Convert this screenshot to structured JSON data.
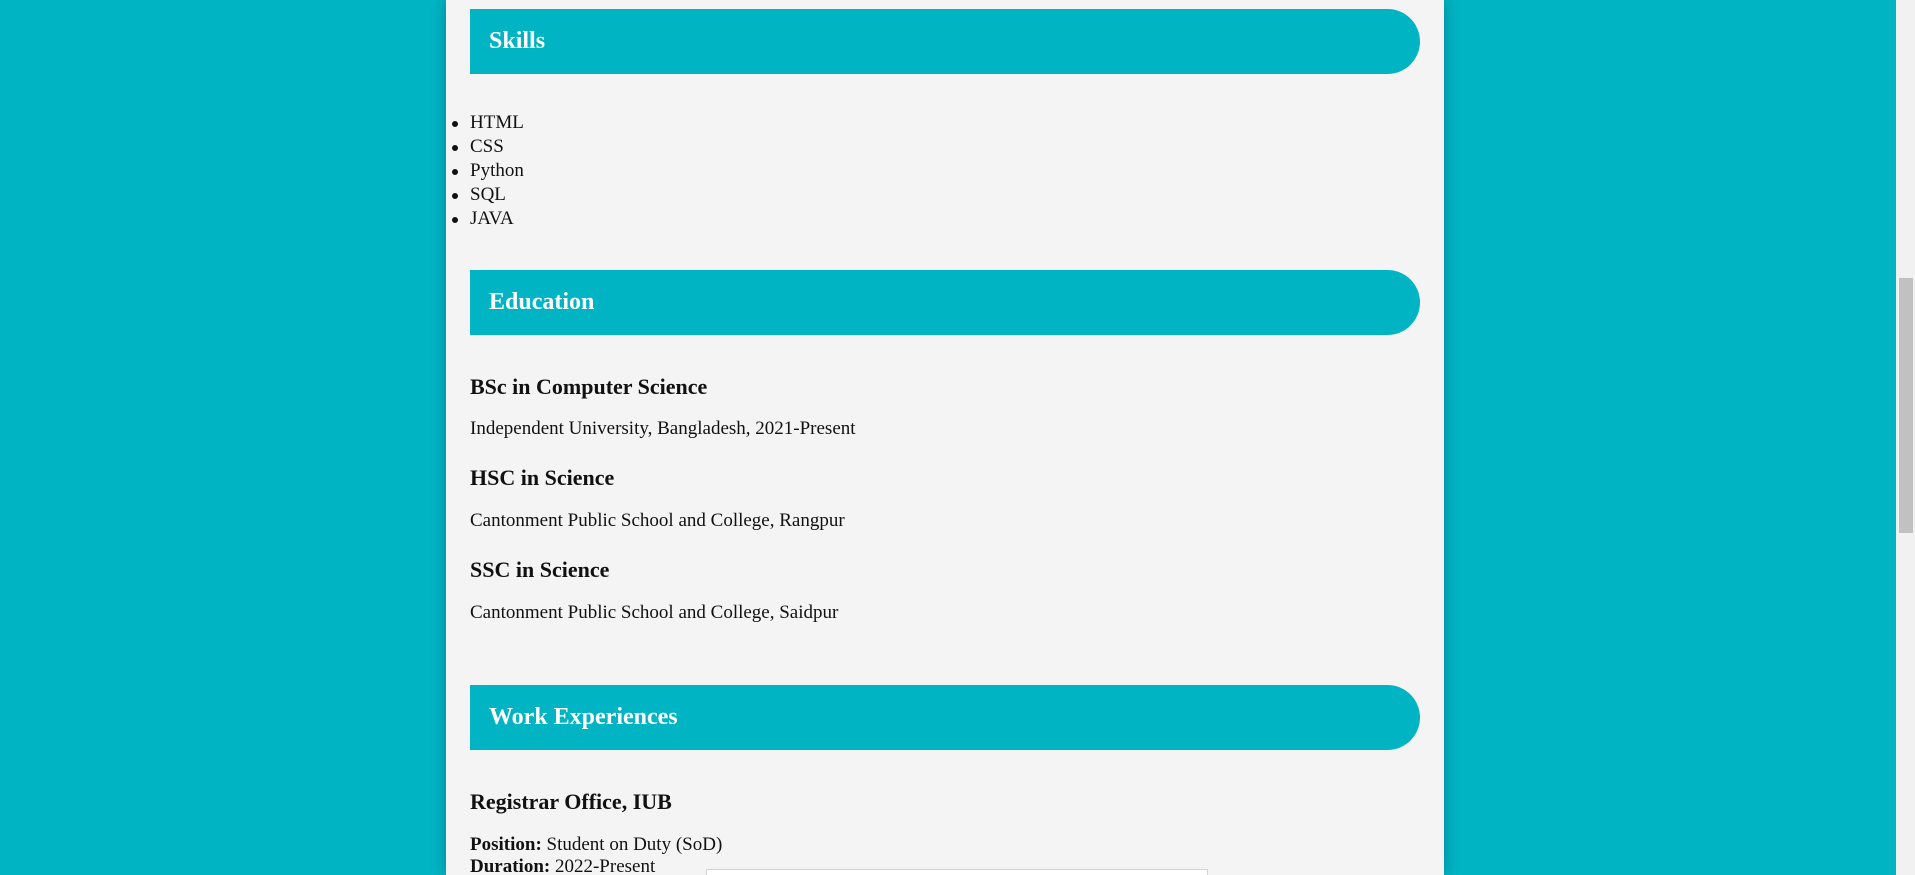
{
  "skills": {
    "heading": "Skills",
    "items": [
      "HTML",
      "CSS",
      "Python",
      "SQL",
      "JAVA"
    ]
  },
  "education": {
    "heading": "Education",
    "entries": [
      {
        "degree": "BSc in Computer Science",
        "detail": "Independent University, Bangladesh, 2021-Present"
      },
      {
        "degree": "HSC in Science",
        "detail": "Cantonment Public School and College, Rangpur"
      },
      {
        "degree": "SSC in Science",
        "detail": "Cantonment Public School and College, Saidpur"
      }
    ]
  },
  "work": {
    "heading": "Work Experiences",
    "entries": [
      {
        "title": "Registrar Office, IUB",
        "position_label": "Position:",
        "position_value": " Student on Duty (SoD)",
        "duration_label": "Duration:",
        "duration_value": " 2022-Present"
      }
    ]
  },
  "colors": {
    "accent": "#00b4c4",
    "page_background": "#f4f4f4",
    "heading_text": "#ffffff"
  }
}
